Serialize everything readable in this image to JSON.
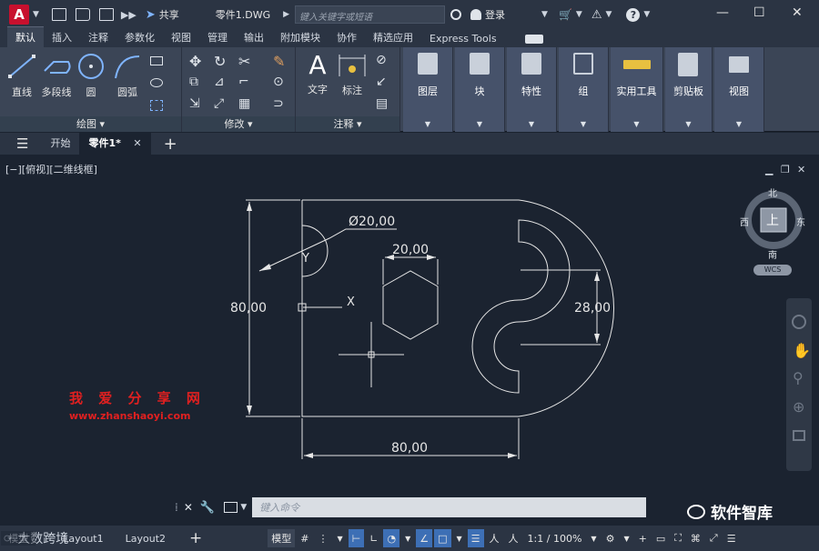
{
  "titlebar": {
    "app_logo": "A",
    "share_label": "共享",
    "doc_title": "零件1.DWG",
    "search_placeholder": "键入关键字或短语",
    "login_label": "登录"
  },
  "ribbon_tabs": [
    "默认",
    "插入",
    "注释",
    "参数化",
    "视图",
    "管理",
    "输出",
    "附加模块",
    "协作",
    "精选应用",
    "Express Tools"
  ],
  "draw_panel": {
    "title": "绘图",
    "tools": [
      "直线",
      "多段线",
      "圆",
      "圆弧"
    ]
  },
  "modify_panel": {
    "title": "修改"
  },
  "annotation_panel": {
    "title": "注释",
    "tools": [
      "文字",
      "标注"
    ]
  },
  "big_panels": [
    "图层",
    "块",
    "特性",
    "组",
    "实用工具",
    "剪贴板",
    "视图"
  ],
  "file_tabs": {
    "start": "开始",
    "active": "零件1*"
  },
  "viewport": {
    "view_label": "[−][俯视][二维线框]",
    "dimensions": {
      "diameter": "Ø20,00",
      "hex_width": "20,00",
      "height": "80,00",
      "slot": "28,00",
      "bottom": "80,00"
    },
    "ucs_x": "X",
    "ucs_y": "Y"
  },
  "viewcube": {
    "north": "北",
    "south": "南",
    "east": "东",
    "west": "西",
    "face": "上",
    "wcs": "WCS"
  },
  "watermark": {
    "line1": "我 爱 分 享 网",
    "line2": "www.zhanshaoyi.com"
  },
  "command_line": {
    "placeholder": "键入命令"
  },
  "brand": {
    "label": "软件智库"
  },
  "status_tabs": [
    "模型",
    "Layout1",
    "Layout2"
  ],
  "status_bar": {
    "model_label": "模型",
    "scale_label": "1:1 / 100%",
    "overlay_text": "大数跨境"
  },
  "colors": {
    "accent": "#3d6fb5",
    "logo": "#c8102e",
    "drawing_line": "#e6e6e6"
  }
}
